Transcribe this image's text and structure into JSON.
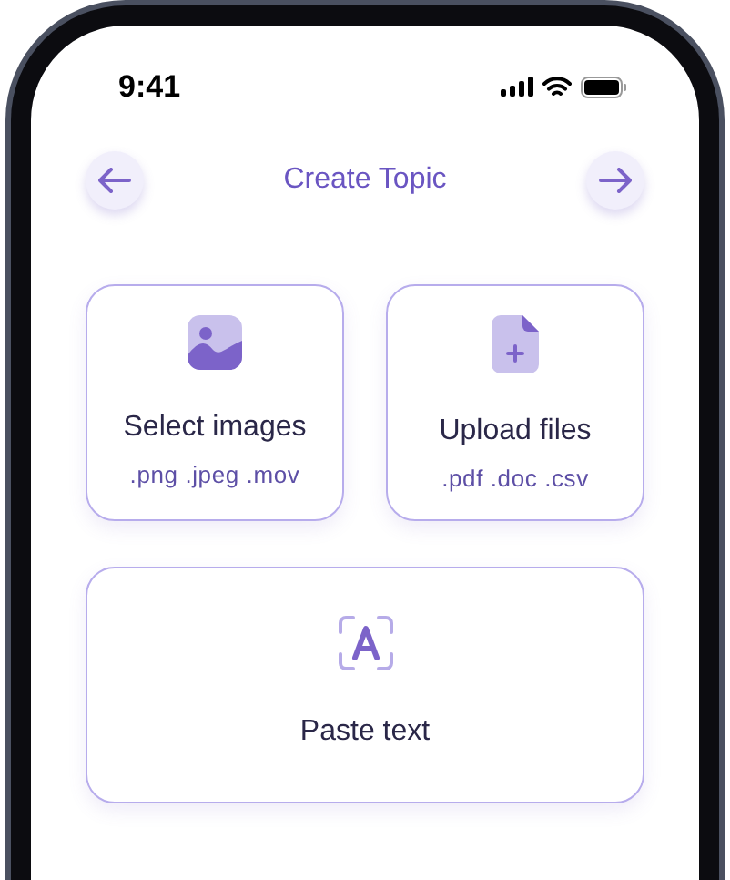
{
  "status_bar": {
    "time": "9:41"
  },
  "header": {
    "title": "Create Topic"
  },
  "options": [
    {
      "kind": "images",
      "title": "Select images",
      "formats": ".png .jpeg .mov"
    },
    {
      "kind": "files",
      "title": "Upload files",
      "formats": ".pdf .doc .csv"
    },
    {
      "kind": "text",
      "title": "Paste text"
    }
  ]
}
